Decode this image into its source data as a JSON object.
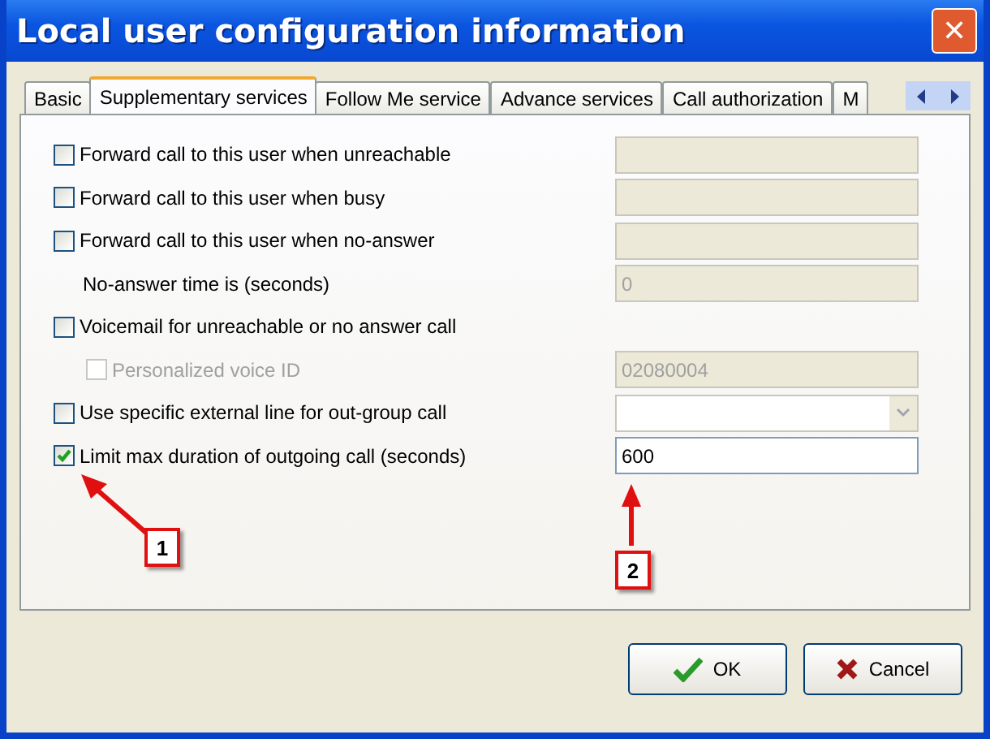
{
  "window": {
    "title": "Local user configuration information",
    "close": "✕"
  },
  "tabs": [
    {
      "label": "Basic",
      "selected": false
    },
    {
      "label": "Supplementary services",
      "selected": true
    },
    {
      "label": "Follow Me service",
      "selected": false
    },
    {
      "label": "Advance services",
      "selected": false
    },
    {
      "label": "Call authorization",
      "selected": false
    },
    {
      "label": "M",
      "selected": false
    }
  ],
  "rows": [
    {
      "kind": "checkbox",
      "label": "Forward call to this user when unreachable",
      "checked": false,
      "disabled": false,
      "field": {
        "kind": "text",
        "disabled": true
      }
    },
    {
      "kind": "checkbox",
      "label": "Forward call to this user when busy",
      "checked": false,
      "disabled": false,
      "field": {
        "kind": "text",
        "disabled": true
      }
    },
    {
      "kind": "checkbox",
      "label": "Forward call to this user when no-answer",
      "checked": false,
      "disabled": false,
      "field": {
        "kind": "text",
        "disabled": true
      }
    },
    {
      "kind": "label",
      "label": "No-answer time is (seconds)",
      "field": {
        "kind": "text",
        "value": "0",
        "disabled": true
      }
    },
    {
      "kind": "checkbox",
      "label": "Voicemail for unreachable or no answer call",
      "checked": false,
      "disabled": false,
      "children": [
        {
          "kind": "checkbox",
          "label": "Personalized voice ID",
          "checked": false,
          "disabled": true,
          "field": {
            "kind": "text",
            "value": "02080004",
            "disabled": true
          }
        }
      ]
    },
    {
      "kind": "checkbox",
      "label": "Use specific external line for out-group call",
      "checked": false,
      "disabled": false,
      "field": {
        "kind": "combo"
      }
    },
    {
      "kind": "checkbox",
      "label": "Limit max duration of outgoing call (seconds)",
      "checked": true,
      "disabled": false,
      "field": {
        "kind": "text",
        "value": "600",
        "disabled": false
      }
    }
  ],
  "callouts": [
    {
      "label": "1"
    },
    {
      "label": "2"
    }
  ],
  "buttons": [
    {
      "kind": "ok",
      "label": "OK"
    },
    {
      "kind": "cancel",
      "label": "Cancel"
    }
  ]
}
